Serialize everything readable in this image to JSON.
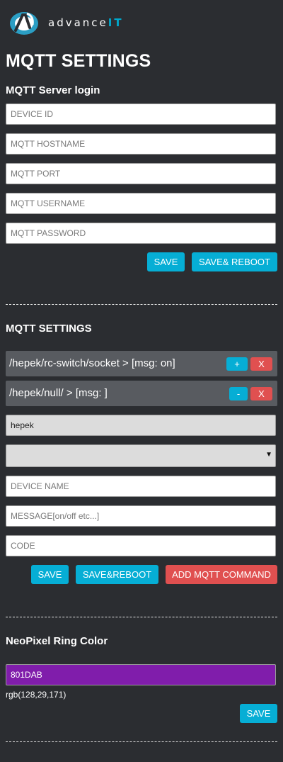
{
  "brand": {
    "logo_text_main": "advance",
    "logo_text_accent": "IT"
  },
  "page_title": "MQTT SETTINGS",
  "server_login": {
    "heading": "MQTT Server login",
    "device_id_placeholder": "DEVICE ID",
    "hostname_placeholder": "MQTT HOSTNAME",
    "port_placeholder": "MQTT PORT",
    "username_placeholder": "MQTT USERNAME",
    "password_placeholder": "MQTT PASSWORD",
    "save_label": "SAVE",
    "save_reboot_label": "SAVE& REBOOT"
  },
  "commands": {
    "heading": "MQTT SETTINGS",
    "rows": [
      {
        "text": "/hepek/rc-switch/socket > [msg: on]",
        "toggle_label": "+",
        "delete_label": "X"
      },
      {
        "text": "/hepek/null/ > [msg: ]",
        "toggle_label": "-",
        "delete_label": "X"
      }
    ],
    "topic_value": "hepek",
    "select_value": "",
    "device_name_placeholder": "DEVICE NAME",
    "message_placeholder": "MESSAGE[on/off etc...]",
    "code_placeholder": "CODE",
    "save_label": "SAVE",
    "save_reboot_label": "SAVE&REBOOT",
    "add_command_label": "ADD MQTT COMMAND"
  },
  "neopixel": {
    "heading": "NeoPixel Ring Color",
    "color_value": "801DAB",
    "rgb_text": "rgb(128,29,171)",
    "save_label": "SAVE"
  },
  "colors": {
    "background": "#2b2d31",
    "accent_cyan": "#06aed5",
    "danger_red": "#e05050",
    "command_row": "#585b60",
    "ring_color": "#801dab"
  }
}
